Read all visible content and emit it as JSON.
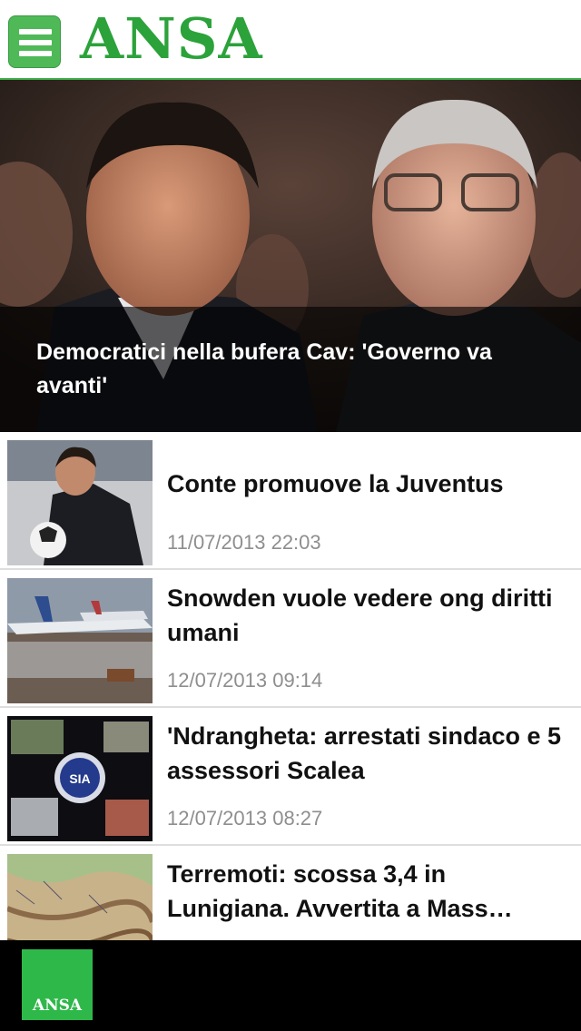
{
  "header": {
    "menu_icon": "hamburger-menu-icon",
    "logo": "ANSA",
    "accent_color": "#3fae49"
  },
  "hero": {
    "title": "Democratici nella bufera Cav: 'Governo va avanti'",
    "image": "photo-two-politicians"
  },
  "articles": [
    {
      "title": "Conte promuove la Juventus",
      "date": "11/07/2013 22:03",
      "image": "photo-coach-with-ball"
    },
    {
      "title": "Snowden vuole vedere ong diritti umani",
      "date": "12/07/2013 09:14",
      "image": "photo-airplanes-flooded-runway"
    },
    {
      "title": "'Ndrangheta: arrestati sindaco e 5 assessori Scalea",
      "date": "12/07/2013 08:27",
      "image": "photo-police-collage"
    },
    {
      "title": "Terremoti: scossa 3,4 in Lunigiana. Avvertita a Mass…",
      "date": "",
      "image": "photo-relief-map"
    }
  ],
  "footer": {
    "tab_label": "ANSA",
    "tab_color": "#2fb84a"
  }
}
